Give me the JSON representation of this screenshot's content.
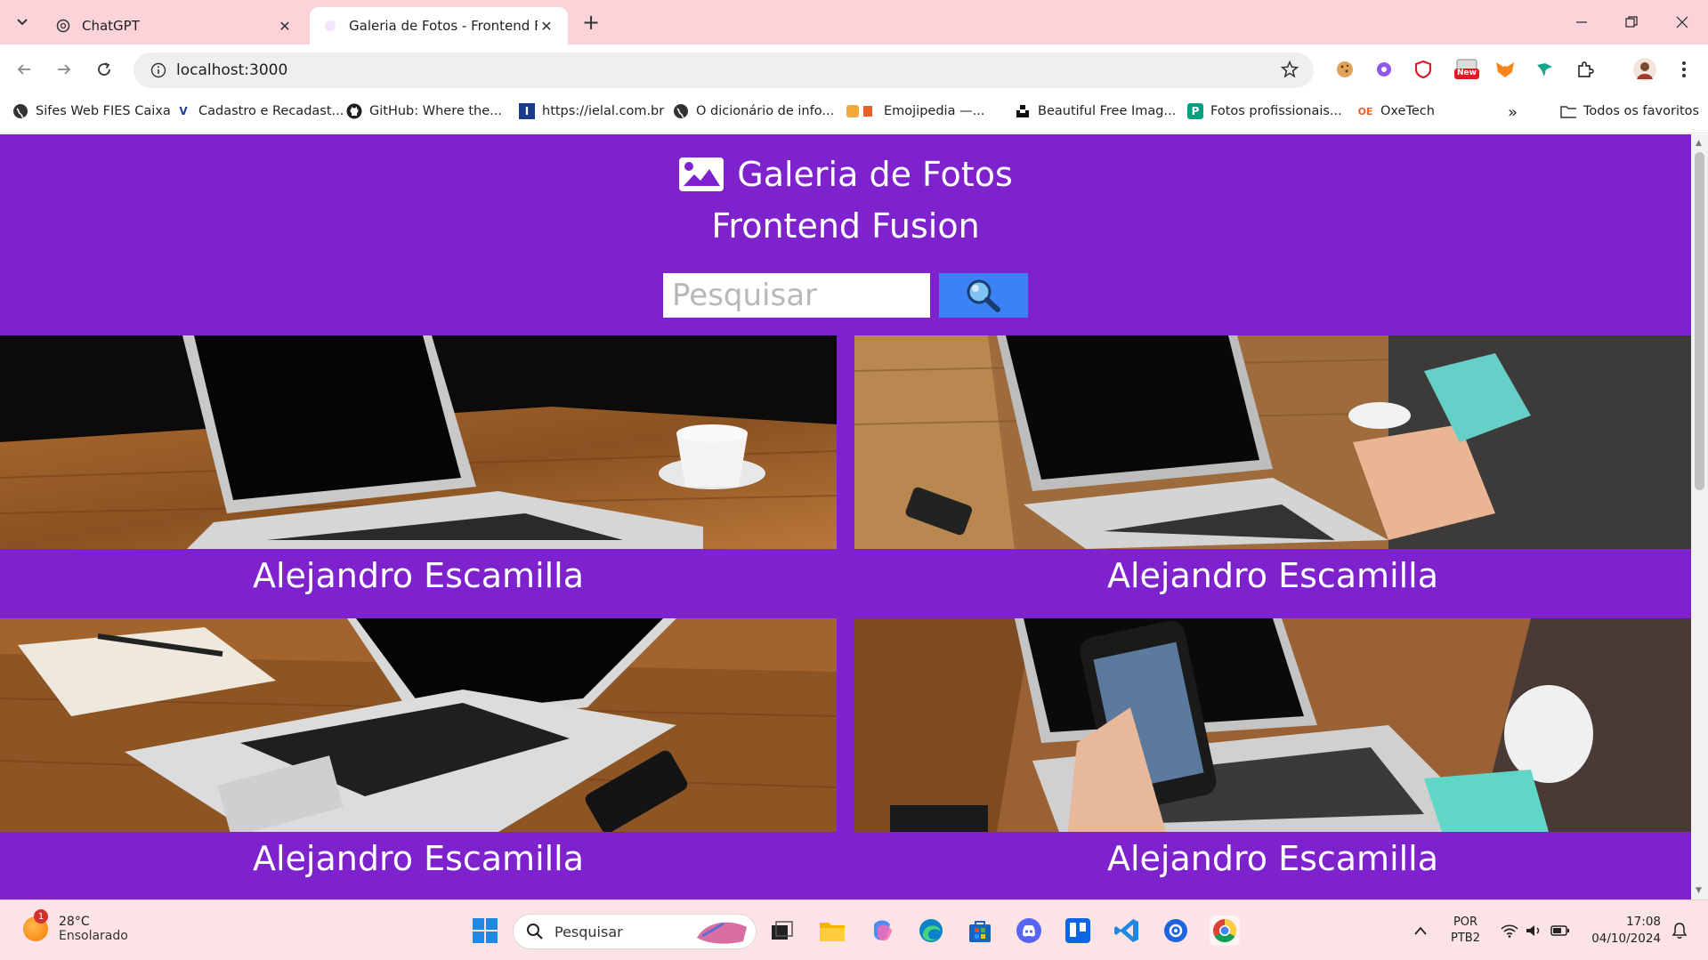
{
  "browser": {
    "tabs": [
      {
        "title": "ChatGPT",
        "active": false
      },
      {
        "title": "Galeria de Fotos - Frontend Fus",
        "active": true
      }
    ],
    "url": "localhost:3000",
    "bookmarks": [
      {
        "label": "Sifes Web FIES Caixa",
        "icon": "globe-icon"
      },
      {
        "label": "Cadastro e Recadast...",
        "icon": "v-logo-icon"
      },
      {
        "label": "GitHub: Where the...",
        "icon": "github-icon"
      },
      {
        "label": "https://ielal.com.br",
        "icon": "ielal-icon"
      },
      {
        "label": "O dicionário de info...",
        "icon": "globe-icon"
      },
      {
        "label": "Emojipedia —...",
        "icon": "emojipedia-icon"
      },
      {
        "label": "Beautiful Free Imag...",
        "icon": "unsplash-icon"
      },
      {
        "label": "Fotos profissionais...",
        "icon": "pexels-icon"
      },
      {
        "label": "OxeTech",
        "icon": "oxetech-icon"
      }
    ],
    "all_bookmarks_label": "Todos os favoritos",
    "new_badge": "New"
  },
  "page": {
    "title": "Galeria de Fotos",
    "subtitle": "Frontend Fusion",
    "search_placeholder": "Pesquisar",
    "photos": [
      {
        "author": "Alejandro Escamilla"
      },
      {
        "author": "Alejandro Escamilla"
      },
      {
        "author": "Alejandro Escamilla"
      },
      {
        "author": "Alejandro Escamilla"
      }
    ],
    "colors": {
      "background": "#7e22ce",
      "search_button": "#3b82f6"
    }
  },
  "taskbar": {
    "weather_temp": "28°C",
    "weather_desc": "Ensolarado",
    "weather_badge": "1",
    "search_label": "Pesquisar",
    "lang_line1": "POR",
    "lang_line2": "PTB2",
    "time": "17:08",
    "date": "04/10/2024"
  }
}
